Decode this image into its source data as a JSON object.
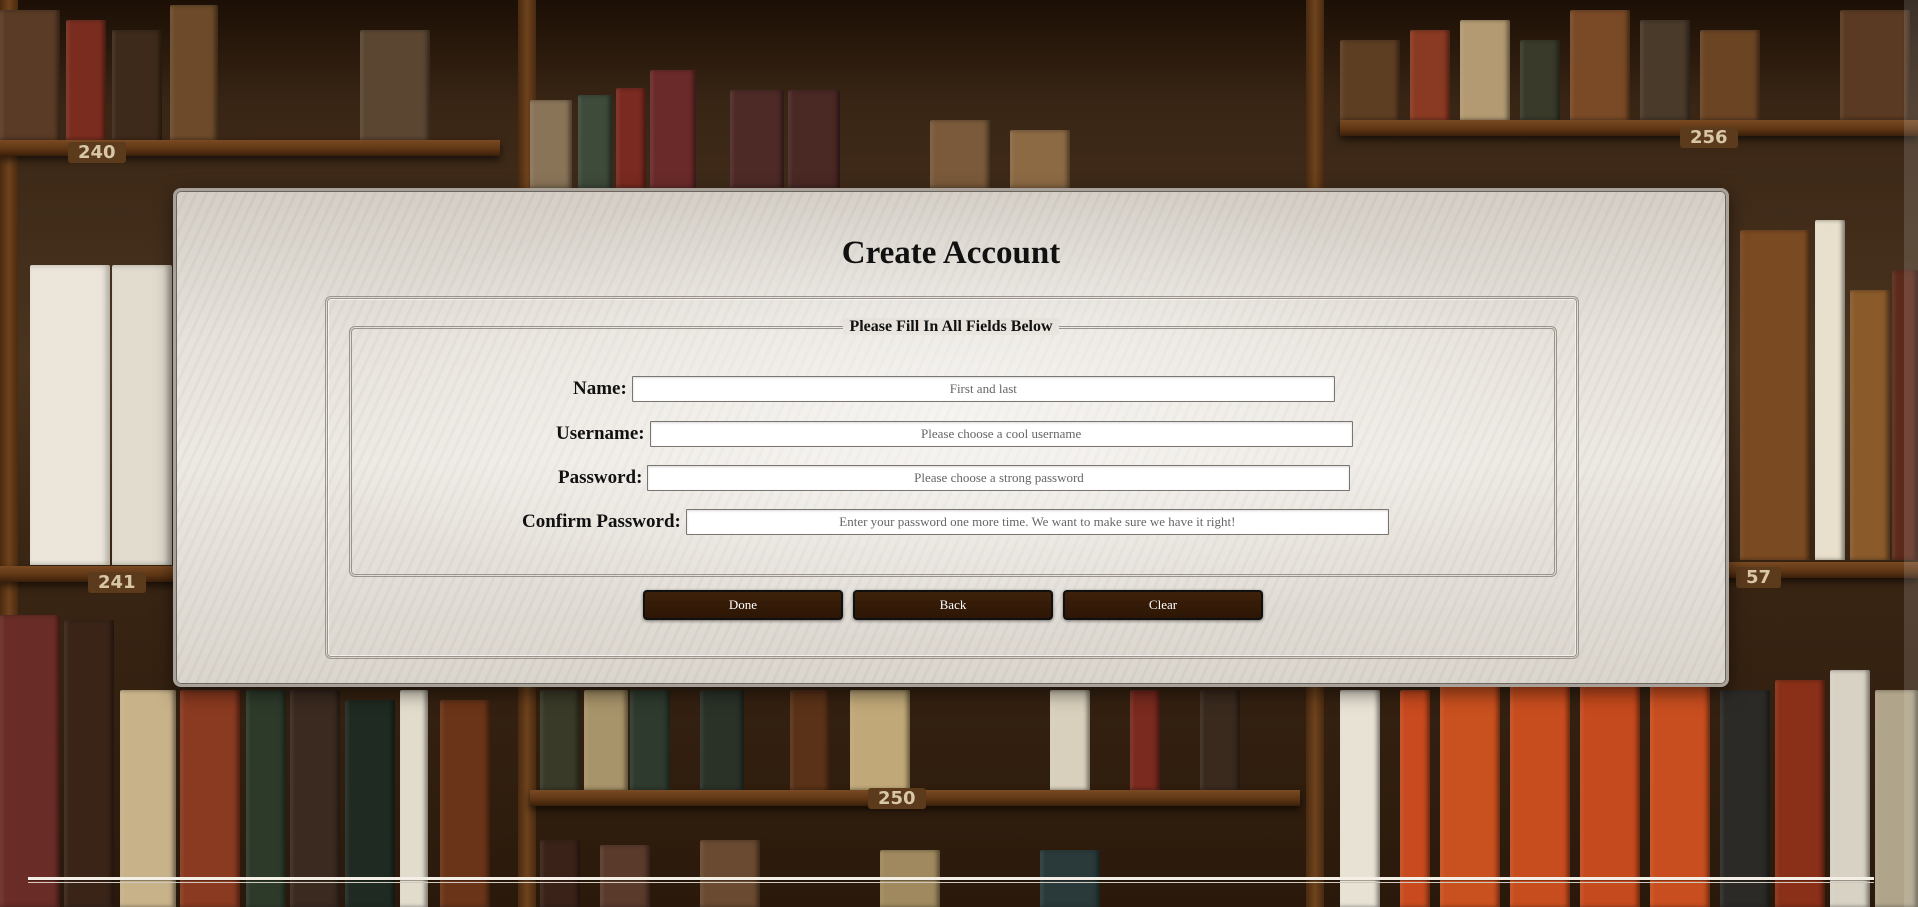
{
  "background": {
    "shelf_numbers": [
      "240",
      "256",
      "241",
      "57",
      "250"
    ]
  },
  "form": {
    "title": "Create Account",
    "legend": "Please Fill In All Fields Below",
    "fields": [
      {
        "label": "Name:",
        "placeholder": "First and last",
        "value": ""
      },
      {
        "label": "Username:",
        "placeholder": "Please choose a cool username",
        "value": ""
      },
      {
        "label": "Password:",
        "placeholder": "Please choose a strong password",
        "value": ""
      },
      {
        "label": "Confirm Password:",
        "placeholder": "Enter your password one more time. We want to make sure we have it right!",
        "value": ""
      }
    ],
    "buttons": {
      "done": "Done",
      "back": "Back",
      "clear": "Clear"
    }
  },
  "colors": {
    "button_bg": "#3a1e08",
    "panel_bg": "#e6e1da",
    "panel_border": "#a9a29a"
  }
}
